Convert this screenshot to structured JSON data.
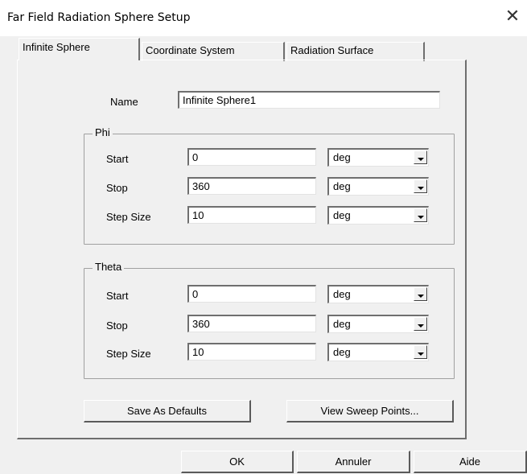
{
  "window": {
    "title": "Far Field Radiation Sphere Setup",
    "close_glyph": "✕"
  },
  "tabs": [
    {
      "label": "Infinite Sphere",
      "active": true
    },
    {
      "label": "Coordinate System",
      "active": false
    },
    {
      "label": "Radiation Surface",
      "active": false
    }
  ],
  "name_field": {
    "label": "Name",
    "value": "Infinite Sphere1"
  },
  "phi": {
    "title": "Phi",
    "start": {
      "label": "Start",
      "value": "0",
      "unit": "deg"
    },
    "stop": {
      "label": "Stop",
      "value": "360",
      "unit": "deg"
    },
    "step": {
      "label": "Step Size",
      "value": "10",
      "unit": "deg"
    }
  },
  "theta": {
    "title": "Theta",
    "start": {
      "label": "Start",
      "value": "0",
      "unit": "deg"
    },
    "stop": {
      "label": "Stop",
      "value": "360",
      "unit": "deg"
    },
    "step": {
      "label": "Step Size",
      "value": "10",
      "unit": "deg"
    }
  },
  "panel_buttons": {
    "save_defaults": "Save As Defaults",
    "view_sweep": "View Sweep Points..."
  },
  "footer_buttons": {
    "ok": "OK",
    "cancel": "Annuler",
    "help": "Aide"
  }
}
